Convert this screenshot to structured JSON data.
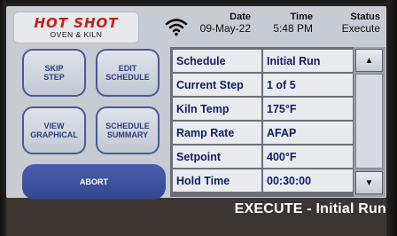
{
  "brand": {
    "name": "HOT SHOT",
    "subtitle": "OVEN & KILN"
  },
  "header": {
    "date_label": "Date",
    "date_value": "09-May-22",
    "time_label": "Time",
    "time_value": "5:48 PM",
    "status_label": "Status",
    "status_value": "Execute",
    "wifi_icon": "wifi-icon"
  },
  "buttons": {
    "skip_step": "SKIP\nSTEP",
    "edit_schedule": "EDIT\nSCHEDULE",
    "view_graphical": "VIEW\nGRAPHICAL",
    "schedule_summary": "SCHEDULE\nSUMMARY",
    "abort": "ABORT"
  },
  "table": {
    "rows": [
      {
        "label": "Schedule",
        "value": "Initial Run"
      },
      {
        "label": "Current Step",
        "value": "1 of 5"
      },
      {
        "label": "Kiln Temp",
        "value": "175°F"
      },
      {
        "label": "Ramp Rate",
        "value": "AFAP"
      },
      {
        "label": "Setpoint",
        "value": "400°F"
      },
      {
        "label": "Hold Time",
        "value": "00:30:00"
      }
    ]
  },
  "scrollbar": {
    "up_icon": "arrow-up-icon",
    "down_icon": "arrow-down-icon",
    "up_glyph": "▲",
    "down_glyph": "▼"
  },
  "footer": {
    "status_text": "EXECUTE - Initial Run"
  },
  "colors": {
    "brand_red": "#c4201b",
    "button_border": "#4a5a96",
    "abort_bg": "#3b4e9a",
    "label_text": "#0c1f66"
  }
}
